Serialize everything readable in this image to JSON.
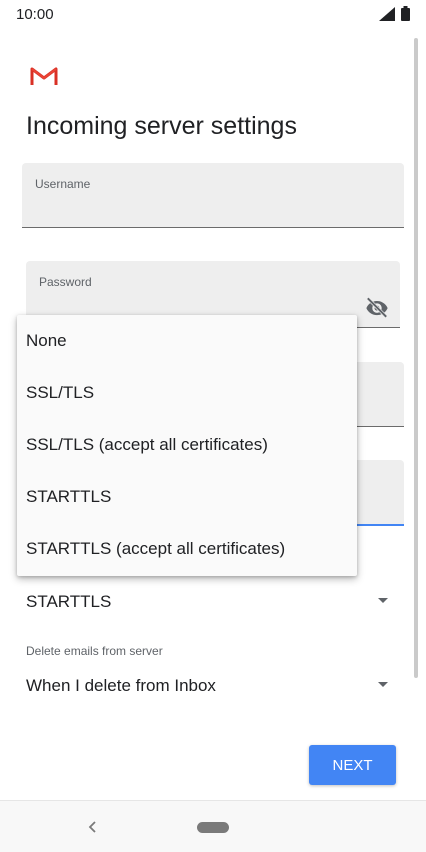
{
  "status_bar": {
    "time": "10:00",
    "icons": [
      "signal-icon",
      "battery-icon"
    ]
  },
  "app": {
    "logo": "gmail-logo",
    "title": "Incoming server settings"
  },
  "fields": {
    "username": {
      "label": "Username",
      "value": ""
    },
    "password": {
      "label": "Password",
      "value": "",
      "toggle_icon": "visibility-off-icon"
    }
  },
  "security": {
    "selected": "STARTTLS",
    "menu_items": [
      "None",
      "SSL/TLS",
      "SSL/TLS (accept all certificates)",
      "STARTTLS",
      "STARTTLS (accept all certificates)"
    ]
  },
  "delete_emails": {
    "label": "Delete emails from server",
    "selected": "When I delete from Inbox"
  },
  "actions": {
    "next_label": "NEXT"
  },
  "colors": {
    "accent": "#4285f4",
    "gmail_red": "#d93025",
    "field_bg": "#eeeeee"
  }
}
